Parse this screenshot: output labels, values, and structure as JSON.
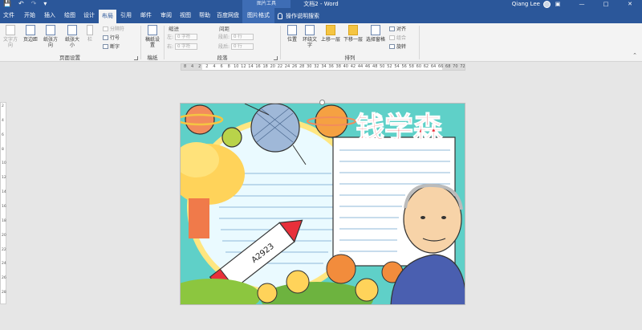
{
  "window": {
    "title": "文档2 - Word",
    "context_tools_label": "图片工具",
    "user_name": "Qiang Lee",
    "qat": [
      "save-icon",
      "undo-icon",
      "redo-icon",
      "customize-icon"
    ]
  },
  "tabs": [
    {
      "label": "文件"
    },
    {
      "label": "开始"
    },
    {
      "label": "插入"
    },
    {
      "label": "绘图"
    },
    {
      "label": "设计"
    },
    {
      "label": "布局"
    },
    {
      "label": "引用"
    },
    {
      "label": "邮件"
    },
    {
      "label": "审阅"
    },
    {
      "label": "视图"
    },
    {
      "label": "帮助"
    },
    {
      "label": "百度网盘"
    },
    {
      "label": "图片格式"
    }
  ],
  "active_tab": "布局",
  "tell_me": "操作说明搜索",
  "ribbon": {
    "page_setup": {
      "label": "页面设置",
      "text_direction": "文字方向",
      "margins": "页边距",
      "orientation": "纸张方向",
      "size": "纸张大小",
      "columns": "栏",
      "breaks": "分隔符",
      "line_numbers": "行号",
      "hyphenation": "断字"
    },
    "draft": {
      "label": "稿纸",
      "draft_settings": "稿纸设置"
    },
    "paragraph": {
      "label": "段落",
      "indent": "缩进",
      "spacing": "间距",
      "left": "左:",
      "right": "右:",
      "before": "段前:",
      "after": "段后:",
      "left_value": "0 字符",
      "right_value": "0 字符",
      "before_value": "0 行",
      "after_value": "0 行"
    },
    "arrange": {
      "label": "排列",
      "position": "位置",
      "wrap_text": "环绕文字",
      "bring_forward": "上移一层",
      "send_backward": "下移一层",
      "selection_pane": "选择窗格",
      "align": "对齐",
      "group": "组合",
      "rotate": "旋转"
    }
  },
  "ruler": {
    "marks": [
      "8",
      "4",
      "2",
      "2",
      "4",
      "6",
      "8",
      "10",
      "12",
      "14",
      "16",
      "18",
      "20",
      "22",
      "24",
      "26",
      "28",
      "30",
      "32",
      "34",
      "36",
      "38",
      "40",
      "42",
      "44",
      "46",
      "48",
      "50",
      "52",
      "54",
      "56",
      "58",
      "60",
      "62",
      "64",
      "66",
      "68",
      "70",
      "72"
    ]
  },
  "vertical_ruler": {
    "marks": [
      "2",
      "4",
      "6",
      "8",
      "10",
      "12",
      "14",
      "16",
      "18",
      "20",
      "22",
      "24",
      "26",
      "28"
    ]
  },
  "poster": {
    "title": "钱学森",
    "rocket_label": "A2923",
    "title_color": "#e8303a",
    "frame_color": "#5fd0c8"
  }
}
